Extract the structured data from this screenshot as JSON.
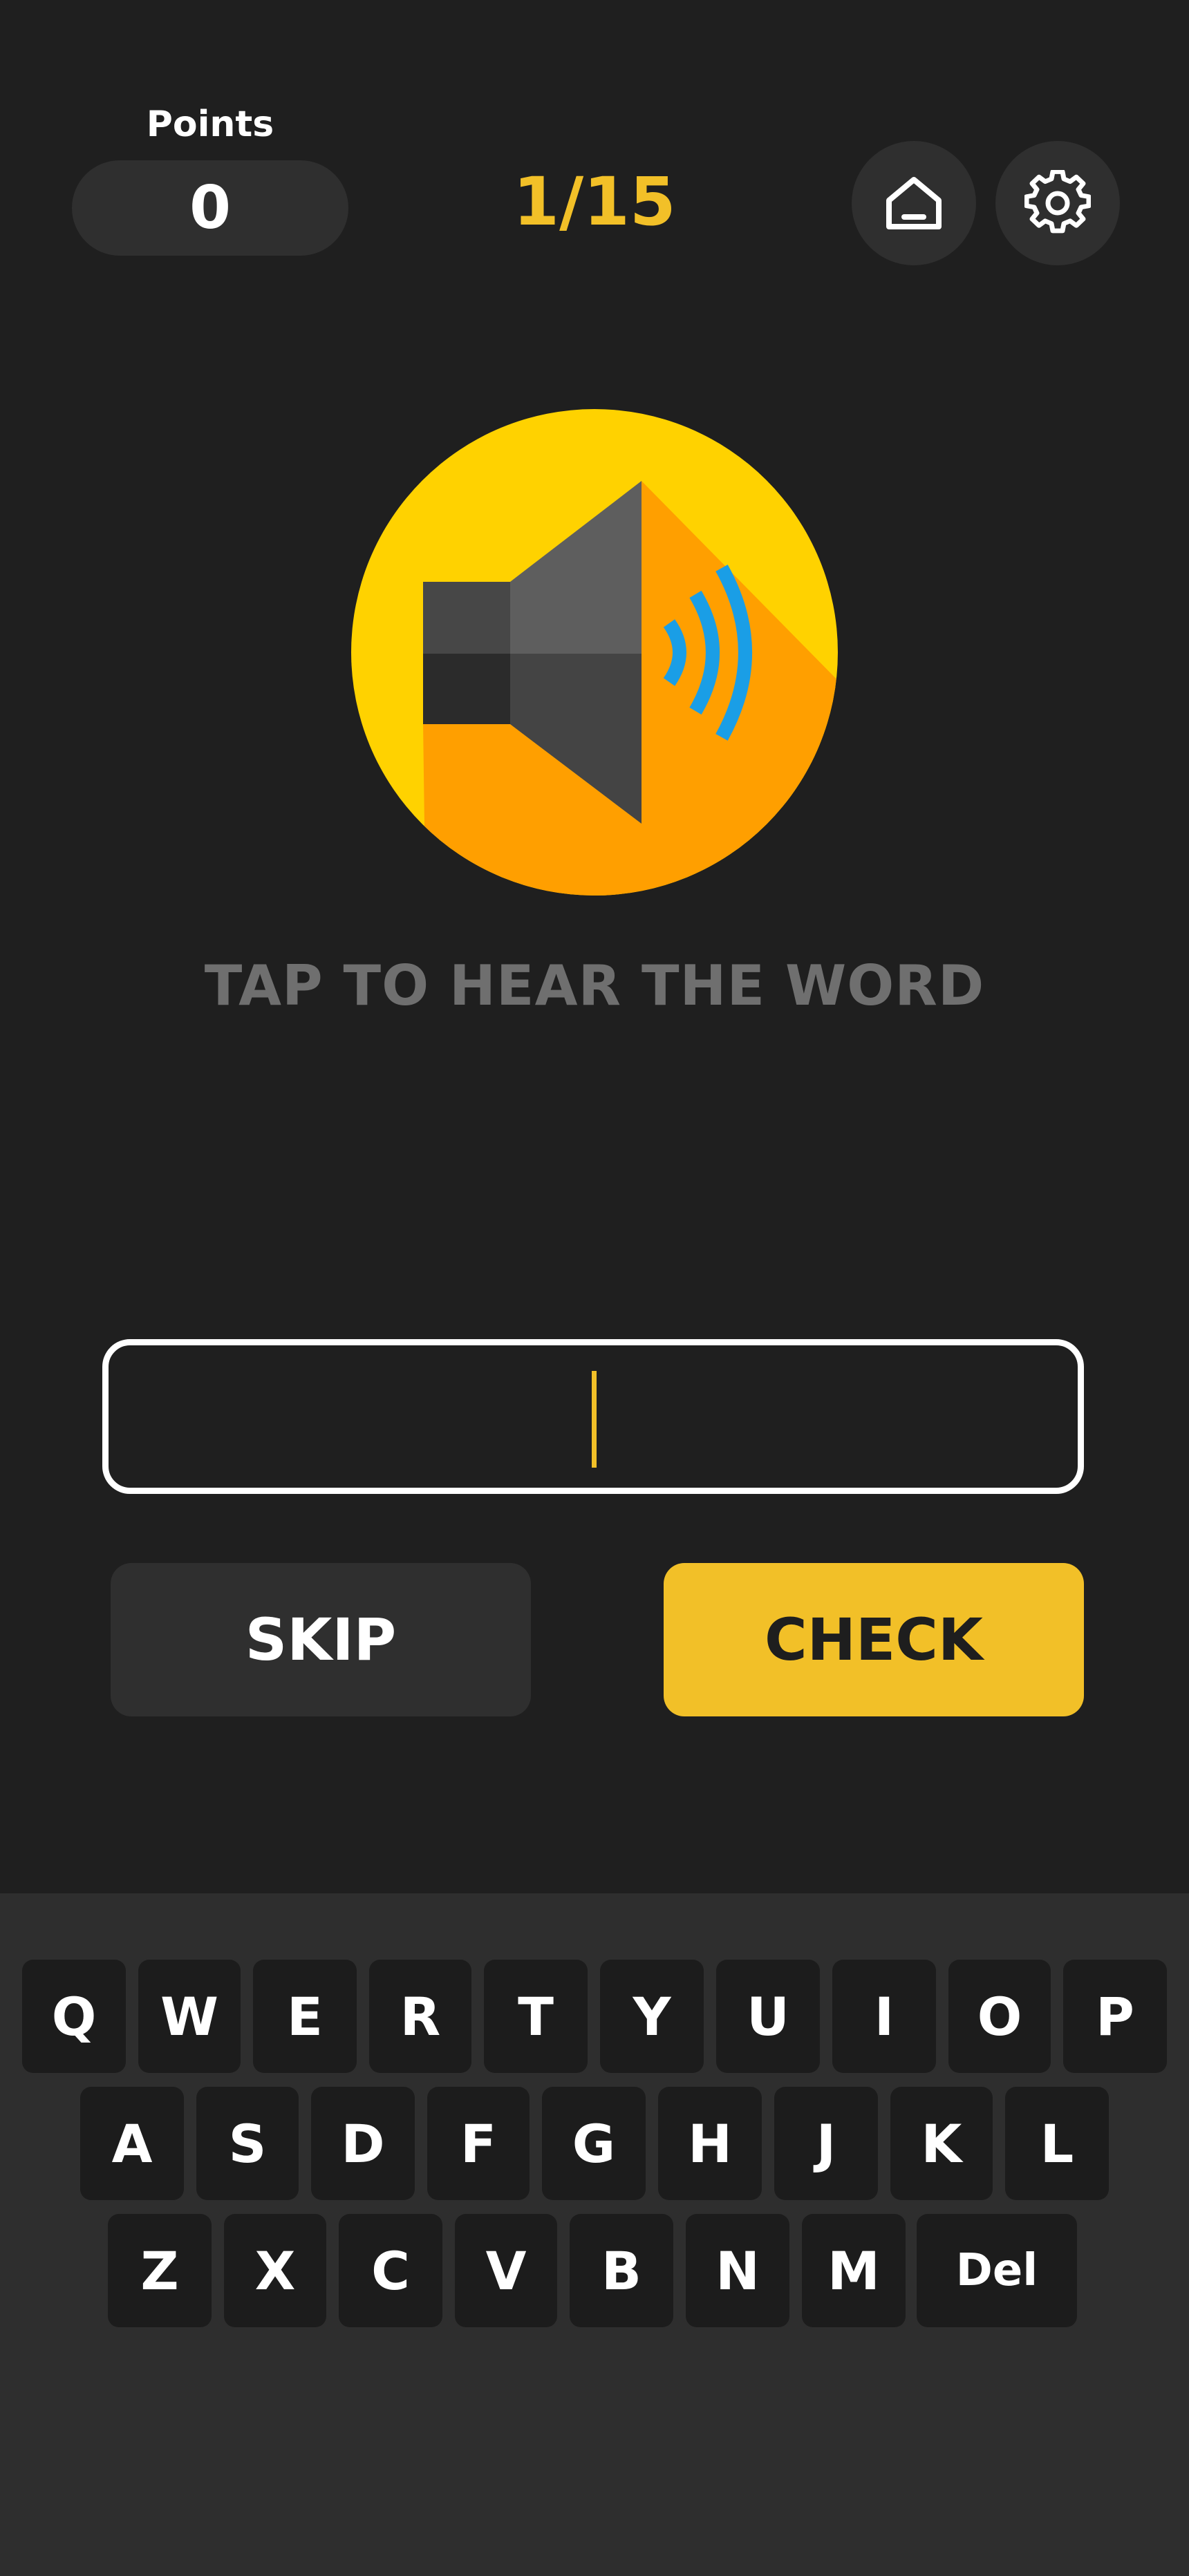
{
  "header": {
    "points_label": "Points",
    "points_value": "0",
    "progress": "1/15",
    "home_icon": "home-icon",
    "settings_icon": "gear-icon"
  },
  "speaker": {
    "icon": "speaker-icon",
    "hint": "TAP TO HEAR THE WORD"
  },
  "answer": {
    "value": "",
    "placeholder": ""
  },
  "buttons": {
    "skip_label": "SKIP",
    "check_label": "CHECK"
  },
  "keyboard": {
    "row1": [
      "Q",
      "W",
      "E",
      "R",
      "T",
      "Y",
      "U",
      "I",
      "O",
      "P"
    ],
    "row2": [
      "A",
      "S",
      "D",
      "F",
      "G",
      "H",
      "J",
      "K",
      "L"
    ],
    "row3": [
      "Z",
      "X",
      "C",
      "V",
      "B",
      "N",
      "M"
    ],
    "delete_label": "Del"
  },
  "colors": {
    "background": "#1f1f1f",
    "accent": "#f2c028",
    "panel": "#2f2f2f",
    "key": "#1c1c1c",
    "speaker_yellow": "#ffd200",
    "speaker_orange": "#ff9f00",
    "waves": "#1a9ee6"
  }
}
